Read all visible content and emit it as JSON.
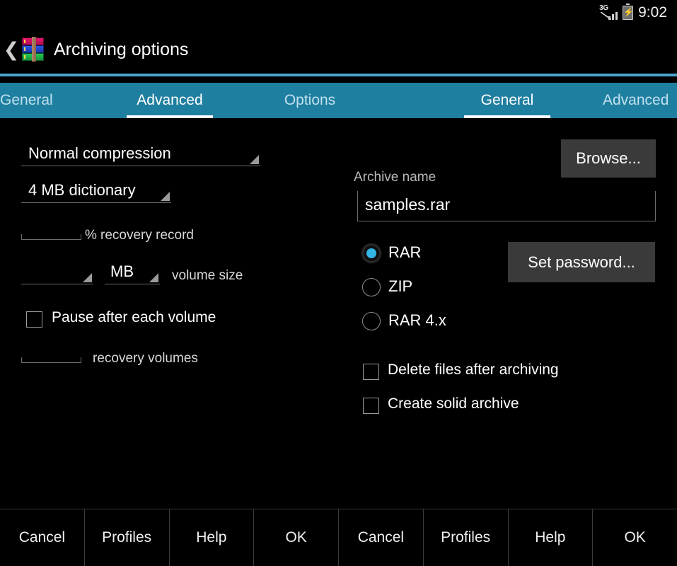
{
  "status_bar": {
    "network_label": "3G",
    "time": "9:02",
    "battery_icon": "battery-charging-icon",
    "signal_icon": "signal-3g-icon"
  },
  "title_bar": {
    "back_icon": "back-chevron-icon",
    "app_icon": "winrar-books-icon",
    "title": "Archiving options"
  },
  "tabs": [
    {
      "label": "General",
      "active": false
    },
    {
      "label": "Advanced",
      "active": true
    },
    {
      "label": "Options",
      "active": false
    },
    {
      "label": "General",
      "active": true
    },
    {
      "label": "Advanced",
      "active": false
    }
  ],
  "advanced_panel": {
    "compression_spinner": {
      "value": "Normal compression"
    },
    "dictionary_spinner": {
      "value": "4 MB dictionary"
    },
    "recovery_record": {
      "value": "",
      "unit": "%",
      "label": "recovery record"
    },
    "volume_size": {
      "value": "",
      "unit_spinner": "MB",
      "label": "volume size"
    },
    "pause_checkbox": {
      "label": "Pause after each volume",
      "checked": false
    },
    "recovery_volumes": {
      "value": "",
      "label": "recovery volumes"
    }
  },
  "general_panel": {
    "browse_button": "Browse...",
    "archive_name_label": "Archive name",
    "archive_name_value": "samples.rar",
    "set_password_button": "Set password...",
    "formats": [
      {
        "label": "RAR",
        "selected": true
      },
      {
        "label": "ZIP",
        "selected": false
      },
      {
        "label": "RAR 4.x",
        "selected": false
      }
    ],
    "delete_files_checkbox": {
      "label": "Delete files after archiving",
      "checked": false
    },
    "solid_archive_checkbox": {
      "label": "Create solid archive",
      "checked": false
    }
  },
  "button_bar": [
    {
      "label": "Cancel"
    },
    {
      "label": "Profiles"
    },
    {
      "label": "Help"
    },
    {
      "label": "OK"
    }
  ],
  "colors": {
    "accent_line": "#4aa6cc",
    "tab_bar": "#1f7fa0",
    "radio_selected": "#33b5e5",
    "button_face": "#3a3a3a",
    "background": "#000000"
  }
}
